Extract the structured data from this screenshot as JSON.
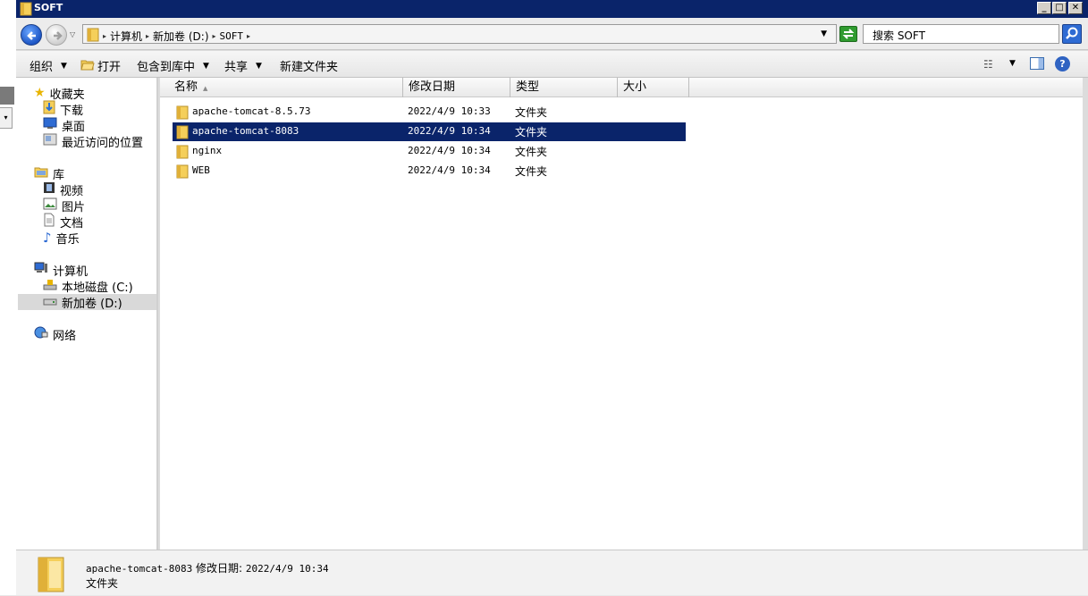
{
  "window": {
    "title": "SOFT"
  },
  "address": {
    "crumbs": [
      "计算机",
      "新加卷 (D:)",
      "SOFT"
    ],
    "search_placeholder": "搜索 SOFT"
  },
  "toolbar": {
    "organize": "组织",
    "open": "打开",
    "include_library": "包含到库中",
    "share": "共享",
    "new_folder": "新建文件夹"
  },
  "nav": {
    "favorites": "收藏夹",
    "downloads": "下载",
    "desktop": "桌面",
    "recent": "最近访问的位置",
    "libraries": "库",
    "videos": "视频",
    "pictures": "图片",
    "documents": "文档",
    "music": "音乐",
    "computer": "计算机",
    "local_disk": "本地磁盘 (C:)",
    "new_volume": "新加卷 (D:)",
    "network": "网络"
  },
  "columns": {
    "name": "名称",
    "modified": "修改日期",
    "type": "类型",
    "size": "大小"
  },
  "files": [
    {
      "name": "apache-tomcat-8.5.73",
      "modified": "2022/4/9 10:33",
      "type": "文件夹",
      "size": ""
    },
    {
      "name": "apache-tomcat-8083",
      "modified": "2022/4/9 10:34",
      "type": "文件夹",
      "size": ""
    },
    {
      "name": "nginx",
      "modified": "2022/4/9 10:34",
      "type": "文件夹",
      "size": ""
    },
    {
      "name": "WEB",
      "modified": "2022/4/9 10:34",
      "type": "文件夹",
      "size": ""
    }
  ],
  "selected_index": 1,
  "details": {
    "name": "apache-tomcat-8083",
    "modified_label": "修改日期:",
    "modified": "2022/4/9 10:34",
    "type": "文件夹"
  },
  "colors": {
    "selection": "#0a246a",
    "titlebar": "#0a246a",
    "folder": "#f5cf5a"
  },
  "icons": {
    "folder": "folder-icon",
    "back": "back-arrow-icon",
    "forward": "forward-arrow-icon",
    "search": "search-icon",
    "refresh": "refresh-icon",
    "help": "help-icon"
  }
}
